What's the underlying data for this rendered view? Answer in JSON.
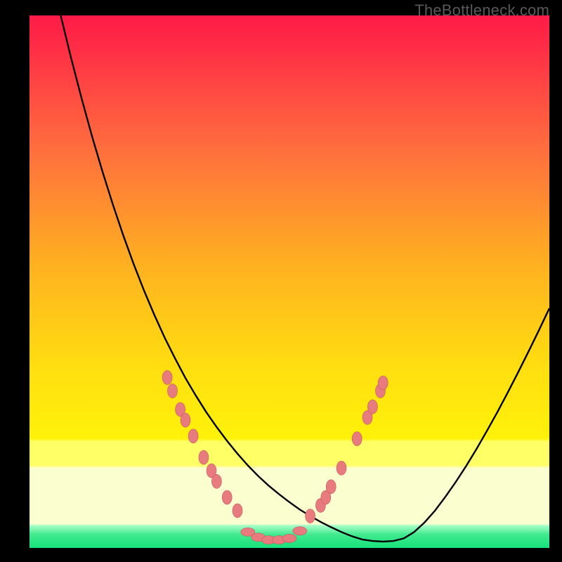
{
  "watermark": "TheBottleneck.com",
  "colors": {
    "frame": "#000000",
    "curve": "#000000",
    "dot_fill": "#e77b7d",
    "dot_stroke": "#c85a5f",
    "grad_top": "#ff1b47",
    "grad_mid1": "#ff6e3e",
    "grad_mid2": "#ffd012",
    "grad_band_yellow": "#ffff66",
    "grad_band_pale": "#fbffd0",
    "grad_green_light": "#7dffb0",
    "grad_green": "#16e27a"
  },
  "chart_data": {
    "type": "line",
    "title": "",
    "xlabel": "",
    "ylabel": "",
    "xlim": [
      0,
      100
    ],
    "ylim": [
      0,
      100
    ],
    "legend": false,
    "grid": false,
    "series": [
      {
        "name": "bottleneck-curve",
        "x": [
          6,
          8,
          10,
          12,
          14,
          16,
          18,
          20,
          22,
          24,
          26,
          28,
          30,
          32,
          34,
          36,
          38,
          40,
          42,
          44,
          46,
          48,
          50,
          52,
          54,
          56,
          58,
          60,
          62,
          64,
          66,
          68,
          70,
          72,
          74,
          76,
          78,
          80,
          82,
          84,
          86,
          88,
          90,
          92,
          94,
          96,
          98,
          100
        ],
        "y": [
          100,
          92,
          84.5,
          77.4,
          70.8,
          64.6,
          58.8,
          53.4,
          48.4,
          43.8,
          39.5,
          35.6,
          31.9,
          28.6,
          25.5,
          22.7,
          20.1,
          17.7,
          15.5,
          13.5,
          11.7,
          10.1,
          8.6,
          7.2,
          6.0,
          4.9,
          3.9,
          3.0,
          2.2,
          1.6,
          1.3,
          1.2,
          1.3,
          1.8,
          3.0,
          4.8,
          7.0,
          9.6,
          12.4,
          15.4,
          18.6,
          22.0,
          25.5,
          29.2,
          33.0,
          36.9,
          40.9,
          45.0
        ]
      }
    ],
    "dots_left": [
      {
        "x": 26.5,
        "y": 32
      },
      {
        "x": 27.5,
        "y": 29.5
      },
      {
        "x": 29,
        "y": 26
      },
      {
        "x": 30,
        "y": 24
      },
      {
        "x": 31.5,
        "y": 21
      },
      {
        "x": 33.5,
        "y": 17
      },
      {
        "x": 35,
        "y": 14.5
      },
      {
        "x": 36,
        "y": 12.5
      },
      {
        "x": 38,
        "y": 9.5
      },
      {
        "x": 40,
        "y": 7
      }
    ],
    "dots_right": [
      {
        "x": 54,
        "y": 6
      },
      {
        "x": 56,
        "y": 8
      },
      {
        "x": 57,
        "y": 9.5
      },
      {
        "x": 58,
        "y": 11.5
      },
      {
        "x": 60,
        "y": 15
      },
      {
        "x": 63,
        "y": 20.5
      },
      {
        "x": 65,
        "y": 24.5
      },
      {
        "x": 66,
        "y": 26.5
      },
      {
        "x": 67.5,
        "y": 29.5
      },
      {
        "x": 68,
        "y": 31
      }
    ],
    "dots_bottom": [
      {
        "x": 42,
        "y": 3
      },
      {
        "x": 44,
        "y": 2
      },
      {
        "x": 46,
        "y": 1.5
      },
      {
        "x": 48,
        "y": 1.5
      },
      {
        "x": 50,
        "y": 1.8
      },
      {
        "x": 52,
        "y": 3.2
      }
    ]
  }
}
